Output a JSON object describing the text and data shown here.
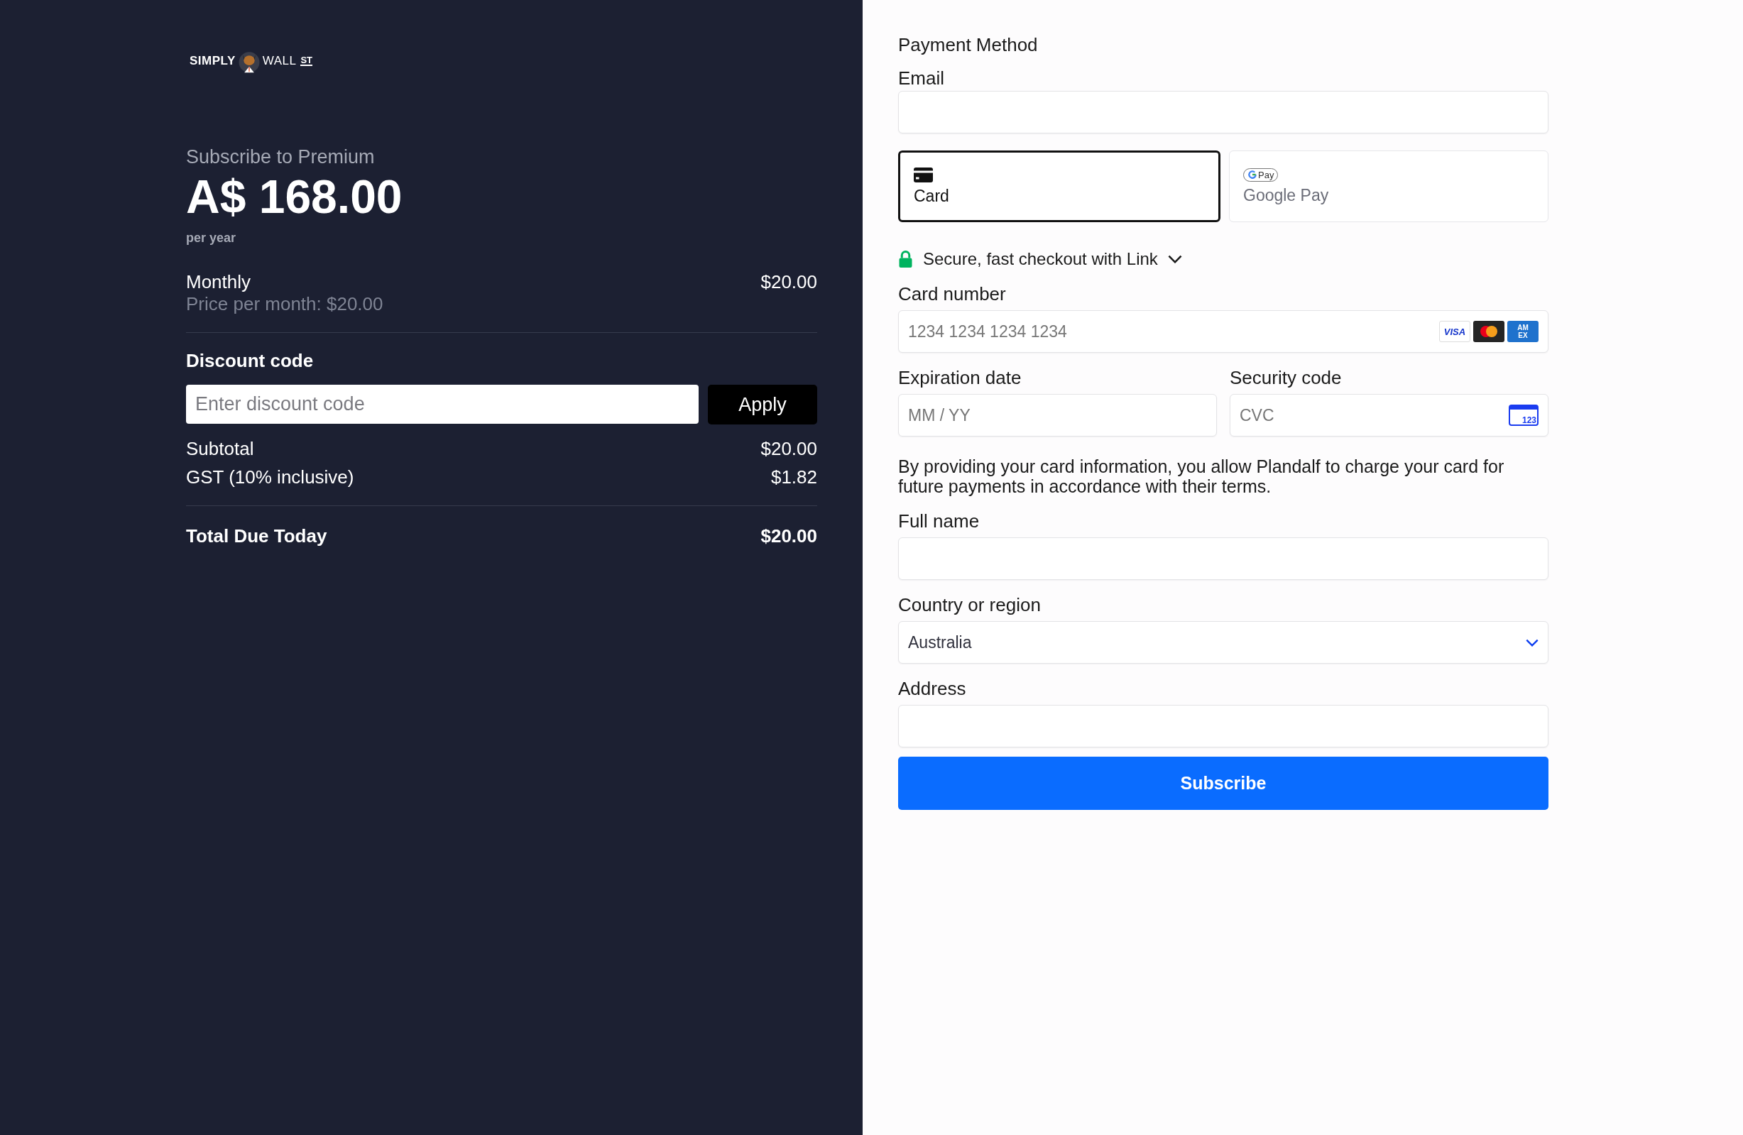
{
  "brand": {
    "part_1": "SIMPLY",
    "part_2": "WALL",
    "part_3": "ST"
  },
  "summary": {
    "heading": "Subscribe to Premium",
    "price": "A$ 168.00",
    "period": "per year"
  },
  "line_item": {
    "name": "Monthly",
    "detail": "Price per month: $20.00",
    "amount": "$20.00"
  },
  "discount": {
    "label": "Discount code",
    "placeholder": "Enter discount code",
    "button": "Apply"
  },
  "totals": [
    {
      "label": "Subtotal",
      "amount": "$20.00",
      "kind": "normal"
    },
    {
      "label": "GST (10% inclusive)",
      "amount": "$1.82",
      "kind": "normal"
    },
    {
      "label": "Total Due Today",
      "amount": "$20.00",
      "kind": "total"
    }
  ],
  "payment": {
    "heading": "Payment Method",
    "email_label": "Email",
    "methods": [
      {
        "label": "Card",
        "kind": "card",
        "selected": true
      },
      {
        "label": "Google Pay",
        "kind": "gpay",
        "badge": "Pay",
        "selected": false
      }
    ],
    "link_text": "Secure, fast checkout with Link",
    "card_number": {
      "label": "Card number",
      "placeholder": "1234 1234 1234 1234",
      "brands": [
        {
          "kind": "visa",
          "text": "VISA"
        },
        {
          "kind": "mastercard"
        },
        {
          "kind": "amex",
          "text": "AM EX"
        }
      ]
    },
    "expiry": {
      "label": "Expiration date",
      "placeholder": "MM / YY"
    },
    "security": {
      "label": "Security code",
      "placeholder": "CVC",
      "icon_text": "123"
    },
    "notice": "By providing your card information, you allow Plandalf to charge your card for future payments in accordance with their terms.",
    "full_name_label": "Full name",
    "country": {
      "label": "Country or region",
      "value": "Australia"
    },
    "address_label": "Address",
    "submit": "Subscribe"
  }
}
